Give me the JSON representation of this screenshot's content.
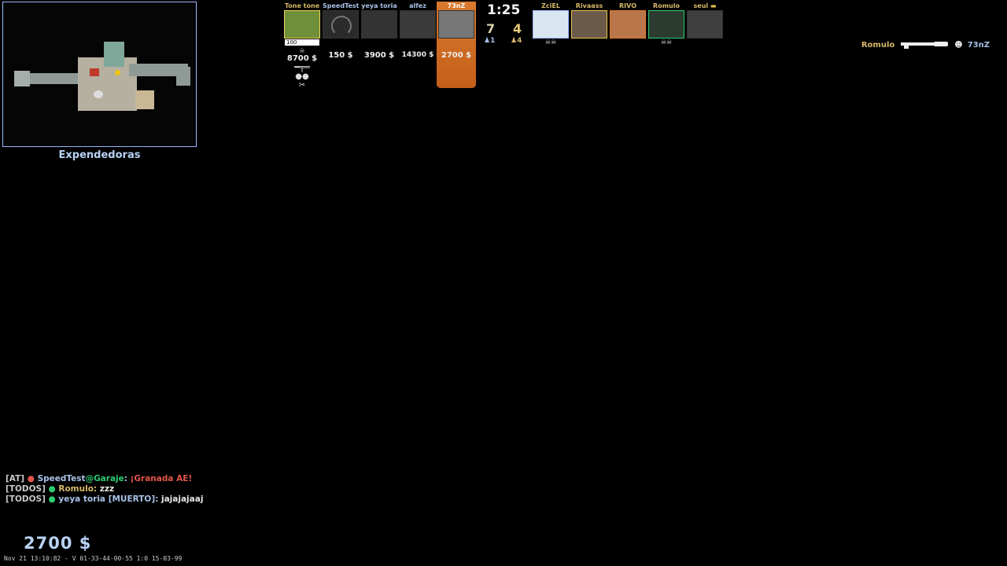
{
  "radar": {
    "location": "Expendedoras"
  },
  "scoreboard": {
    "clock": "1:25",
    "t_score": "7",
    "ct_score": "4",
    "t_alive": "♟1",
    "ct_alive": "♟4",
    "t_players": [
      {
        "name": "Tone tone",
        "money": "8700 $",
        "hp": "100",
        "avatar_color": "#6f8f3a"
      },
      {
        "name": "SpeedTest",
        "money": "150 $",
        "avatar_color": "#2b2b2b"
      },
      {
        "name": "yeya toria",
        "money": "3900 $",
        "avatar_color": "#333333"
      },
      {
        "name": "alfez",
        "money": "14300 $",
        "avatar_color": "#3a3a3a"
      },
      {
        "name": "73nZ",
        "money": "2700 $",
        "avatar_color": "#555555"
      }
    ],
    "ct_players": [
      {
        "name": "ZciEL",
        "avatar_color": "#d8e6f2"
      },
      {
        "name": "Rivaass",
        "avatar_color": "#6b5a4a"
      },
      {
        "name": "RIVO",
        "avatar_color": "#b8764a"
      },
      {
        "name": "Romulo",
        "avatar_color": "#2b3b30"
      },
      {
        "name": "seul",
        "avatar_color": "#3f3f3f"
      }
    ]
  },
  "killfeed": {
    "killer": "Romulo",
    "victim": "73nZ"
  },
  "chat": [
    {
      "prefix": "[AT]",
      "player": "SpeedTest",
      "location": "@Garaje",
      "message": "¡Granada AE!"
    },
    {
      "prefix": "[TODOS]",
      "player": "Romulo",
      "status": "",
      "message": "zzz"
    },
    {
      "prefix": "[TODOS]",
      "player": "yeya toria",
      "status": "[MUERTO]",
      "message": "jajajajaaj"
    }
  ],
  "hud": {
    "money": "2700 $"
  },
  "timestamp": "Nov 21 13:10:82 - V 01-33-44-00-55 1:0 15-03-99",
  "colors": {
    "ct": "#a8c2e8",
    "t": "#d6b868",
    "highlight": "#d9792e",
    "chat_red": "#e3564b"
  }
}
